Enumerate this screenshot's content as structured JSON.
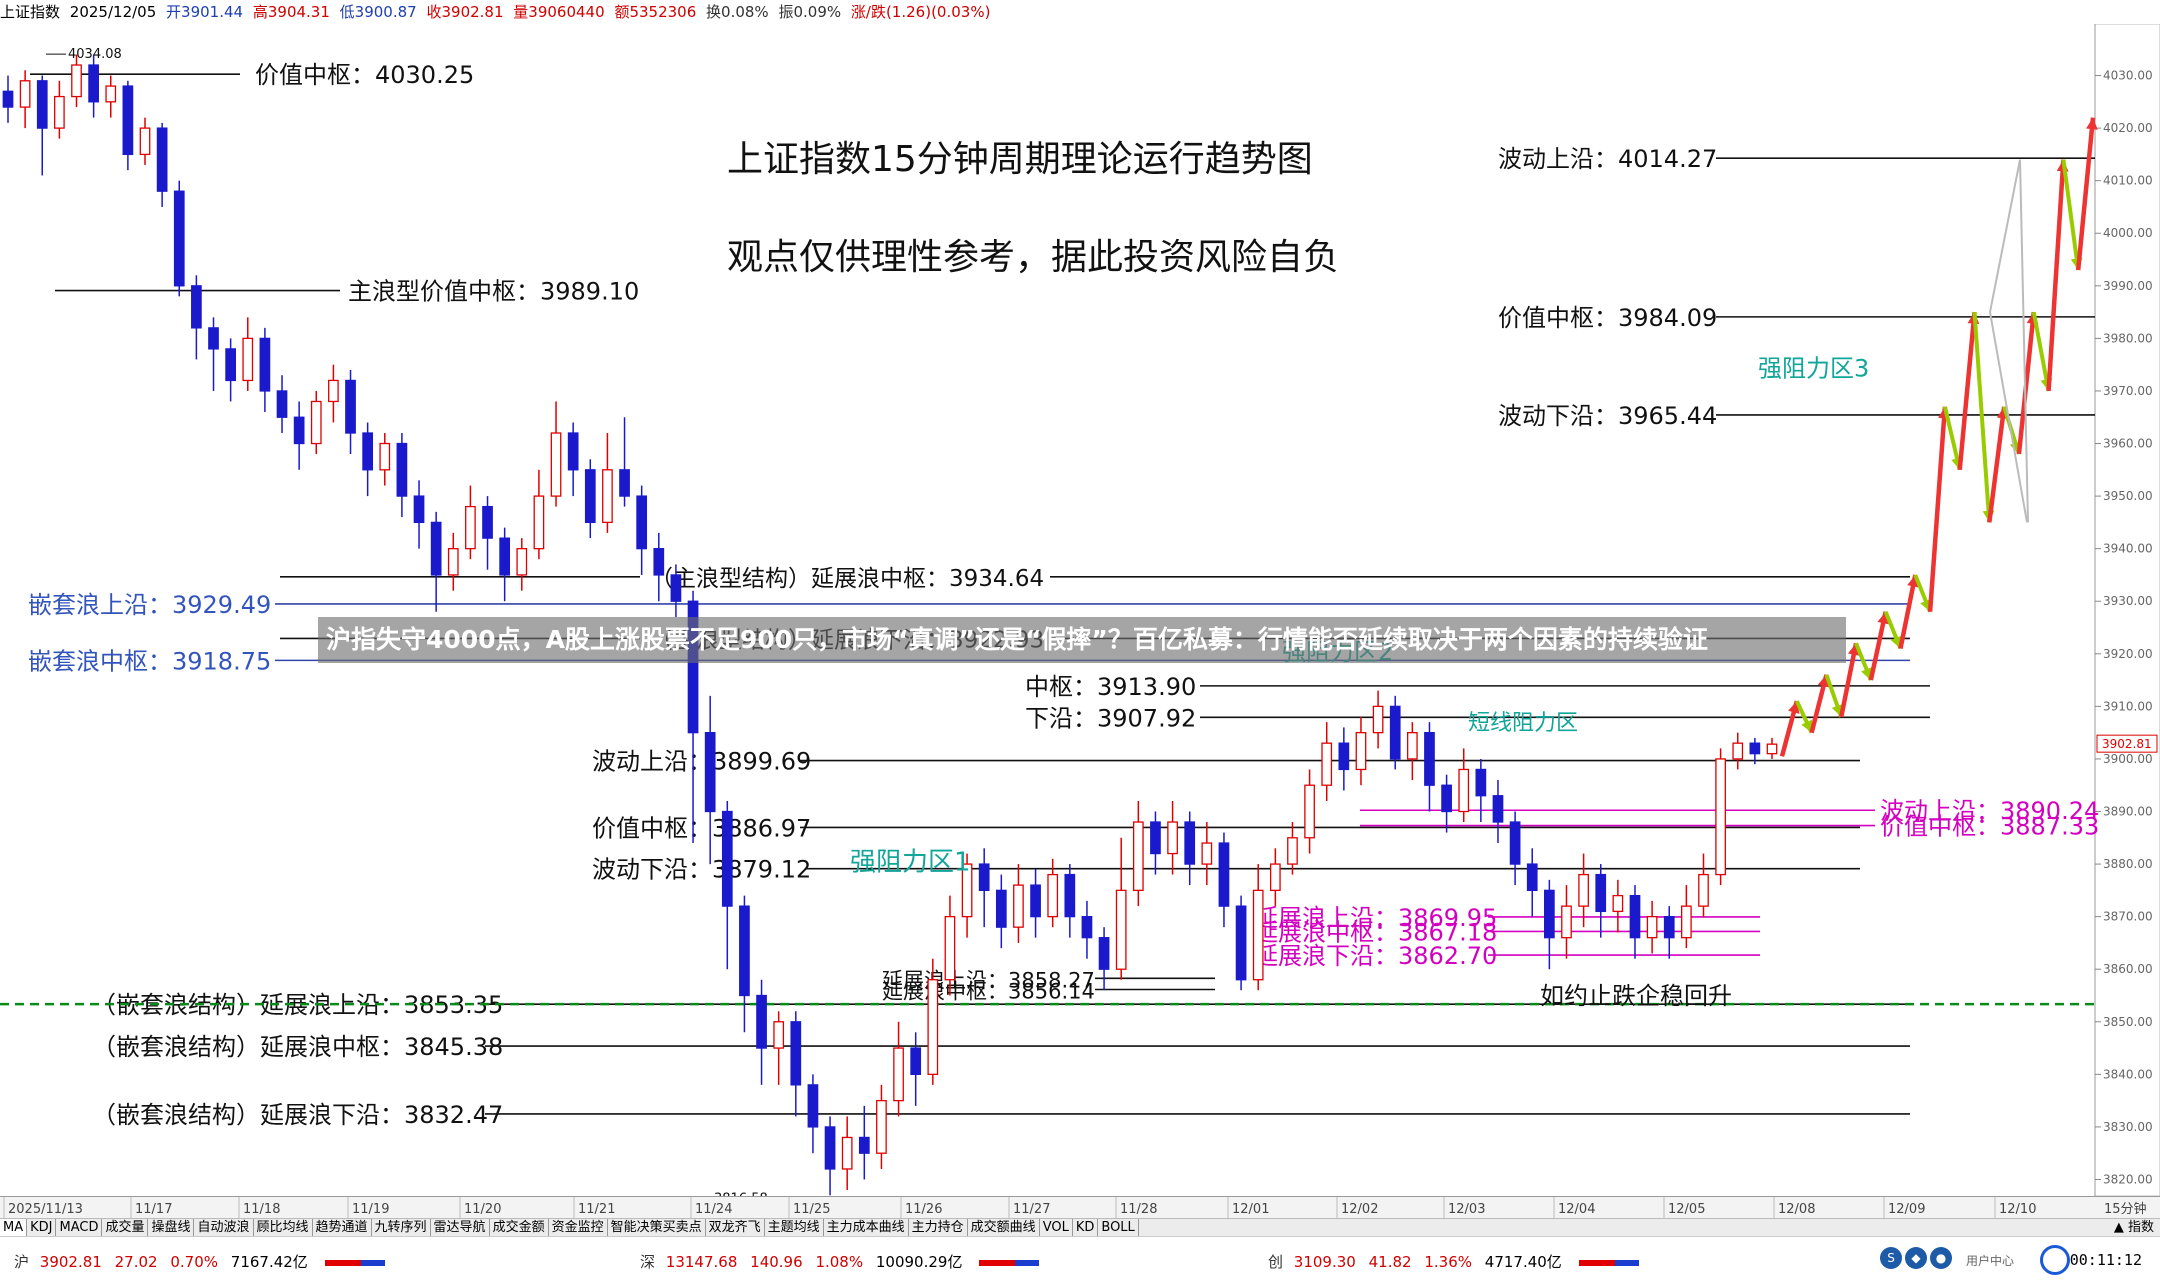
{
  "header": {
    "name": "上证指数",
    "date": "2025/12/05",
    "open": "开3901.44",
    "high": "高3904.31",
    "low": "低3900.87",
    "close": "收3902.81",
    "volume": "量39060440",
    "amount": "额5352306",
    "turnover": "换0.08%",
    "amplitude": "振0.09%",
    "change": "涨/跌(1.26)(0.03%)"
  },
  "chart_data": {
    "type": "candlestick",
    "title": "上证指数15分钟周期理论运行趋势图",
    "subtitle": "观点仅供理性参考，据此投资风险自负",
    "banner": "沪指失守4000点，A股上涨股票不足900只，市场“真调”还是“假摔”？百亿私募：行情能否延续取决于两个因素的持续验证",
    "ylim": [
      3818,
      4036
    ],
    "y_ticks": [
      4030,
      4020,
      4010,
      4000,
      3990,
      3980,
      3970,
      3960,
      3950,
      3940,
      3930,
      3920,
      3910,
      3900,
      3890,
      3880,
      3870,
      3860,
      3850,
      3840,
      3830,
      3820
    ],
    "y_tick_labels": [
      "4030.00",
      "4020.00",
      "4010.00",
      "4000.00",
      "3990.00",
      "3980.00",
      "3970.00",
      "3960.00",
      "3950.00",
      "3940.00",
      "3930.00",
      "3920.00",
      "3910.00",
      "3900.00",
      "3890.00",
      "3880.00",
      "3870.00",
      "3860.00",
      "3850.00",
      "3840.00",
      "3830.00",
      "3820.00"
    ],
    "last_price_label": "3902.81",
    "x_ticks": [
      "2025/11/13",
      "11/17",
      "11/18",
      "11/19",
      "11/20",
      "11/21",
      "11/24",
      "11/25",
      "11/26",
      "11/27",
      "11/28",
      "12/01",
      "12/02",
      "12/03",
      "12/04",
      "12/05",
      "12/08",
      "12/09",
      "12/10"
    ],
    "x_label": "15分钟",
    "peak_label": "4034.08",
    "trough_label": "3816.58",
    "candles": [
      [
        4027,
        4024,
        4030,
        4021
      ],
      [
        4024,
        4029,
        4031,
        4020
      ],
      [
        4029,
        4020,
        4030,
        4011
      ],
      [
        4020,
        4026,
        4029,
        4018
      ],
      [
        4026,
        4032,
        4034,
        4024
      ],
      [
        4032,
        4025,
        4034,
        4022
      ],
      [
        4025,
        4028,
        4030,
        4022
      ],
      [
        4028,
        4015,
        4029,
        4012
      ],
      [
        4015,
        4020,
        4022,
        4013
      ],
      [
        4020,
        4008,
        4021,
        4005
      ],
      [
        4008,
        3990,
        4010,
        3988
      ],
      [
        3990,
        3982,
        3992,
        3976
      ],
      [
        3982,
        3978,
        3984,
        3970
      ],
      [
        3978,
        3972,
        3980,
        3968
      ],
      [
        3972,
        3980,
        3984,
        3970
      ],
      [
        3980,
        3970,
        3982,
        3966
      ],
      [
        3970,
        3965,
        3973,
        3962
      ],
      [
        3965,
        3960,
        3968,
        3955
      ],
      [
        3960,
        3968,
        3970,
        3958
      ],
      [
        3968,
        3972,
        3975,
        3964
      ],
      [
        3972,
        3962,
        3974,
        3958
      ],
      [
        3962,
        3955,
        3964,
        3950
      ],
      [
        3955,
        3960,
        3962,
        3952
      ],
      [
        3960,
        3950,
        3962,
        3946
      ],
      [
        3950,
        3945,
        3953,
        3940
      ],
      [
        3945,
        3935,
        3947,
        3928
      ],
      [
        3935,
        3940,
        3943,
        3932
      ],
      [
        3940,
        3948,
        3952,
        3938
      ],
      [
        3948,
        3942,
        3950,
        3936
      ],
      [
        3942,
        3935,
        3944,
        3930
      ],
      [
        3935,
        3940,
        3942,
        3932
      ],
      [
        3940,
        3950,
        3955,
        3938
      ],
      [
        3950,
        3962,
        3968,
        3948
      ],
      [
        3962,
        3955,
        3964,
        3950
      ],
      [
        3955,
        3945,
        3957,
        3942
      ],
      [
        3945,
        3955,
        3962,
        3943
      ],
      [
        3955,
        3950,
        3965,
        3948
      ],
      [
        3950,
        3940,
        3952,
        3935
      ],
      [
        3940,
        3935,
        3943,
        3930
      ],
      [
        3935,
        3930,
        3937,
        3927
      ],
      [
        3930,
        3905,
        3932,
        3884
      ],
      [
        3905,
        3890,
        3912,
        3880
      ],
      [
        3890,
        3872,
        3892,
        3860
      ],
      [
        3872,
        3855,
        3874,
        3848
      ],
      [
        3855,
        3845,
        3858,
        3838
      ],
      [
        3845,
        3850,
        3852,
        3838
      ],
      [
        3850,
        3838,
        3852,
        3832
      ],
      [
        3838,
        3830,
        3840,
        3825
      ],
      [
        3830,
        3822,
        3832,
        3817
      ],
      [
        3822,
        3828,
        3832,
        3818
      ],
      [
        3828,
        3825,
        3834,
        3820
      ],
      [
        3825,
        3835,
        3838,
        3822
      ],
      [
        3835,
        3845,
        3850,
        3832
      ],
      [
        3845,
        3840,
        3848,
        3834
      ],
      [
        3840,
        3858,
        3862,
        3838
      ],
      [
        3858,
        3870,
        3874,
        3855
      ],
      [
        3870,
        3880,
        3882,
        3866
      ],
      [
        3880,
        3875,
        3883,
        3868
      ],
      [
        3875,
        3868,
        3878,
        3864
      ],
      [
        3868,
        3876,
        3880,
        3865
      ],
      [
        3876,
        3870,
        3879,
        3866
      ],
      [
        3870,
        3878,
        3881,
        3868
      ],
      [
        3878,
        3870,
        3880,
        3866
      ],
      [
        3870,
        3866,
        3873,
        3862
      ],
      [
        3866,
        3860,
        3868,
        3856
      ],
      [
        3860,
        3875,
        3885,
        3858
      ],
      [
        3875,
        3888,
        3892,
        3872
      ],
      [
        3888,
        3882,
        3890,
        3878
      ],
      [
        3882,
        3888,
        3892,
        3878
      ],
      [
        3888,
        3880,
        3890,
        3876
      ],
      [
        3880,
        3884,
        3888,
        3876
      ],
      [
        3884,
        3872,
        3886,
        3868
      ],
      [
        3872,
        3858,
        3874,
        3856
      ],
      [
        3858,
        3875,
        3880,
        3856
      ],
      [
        3875,
        3880,
        3883,
        3872
      ],
      [
        3880,
        3885,
        3888,
        3878
      ],
      [
        3885,
        3895,
        3898,
        3882
      ],
      [
        3895,
        3903,
        3907,
        3892
      ],
      [
        3903,
        3898,
        3906,
        3894
      ],
      [
        3898,
        3905,
        3908,
        3895
      ],
      [
        3905,
        3910,
        3913,
        3902
      ],
      [
        3910,
        3900,
        3912,
        3898
      ],
      [
        3900,
        3905,
        3907,
        3896
      ],
      [
        3905,
        3895,
        3907,
        3890
      ],
      [
        3895,
        3890,
        3897,
        3886
      ],
      [
        3890,
        3898,
        3902,
        3888
      ],
      [
        3898,
        3893,
        3900,
        3888
      ],
      [
        3893,
        3888,
        3896,
        3884
      ],
      [
        3888,
        3880,
        3890,
        3876
      ],
      [
        3880,
        3875,
        3883,
        3870
      ],
      [
        3875,
        3866,
        3877,
        3860
      ],
      [
        3866,
        3872,
        3876,
        3862
      ],
      [
        3872,
        3878,
        3882,
        3868
      ],
      [
        3878,
        3871,
        3880,
        3866
      ],
      [
        3871,
        3874,
        3877,
        3867
      ],
      [
        3874,
        3866,
        3876,
        3862
      ],
      [
        3866,
        3870,
        3873,
        3863
      ],
      [
        3870,
        3866,
        3872,
        3862
      ],
      [
        3866,
        3872,
        3876,
        3864
      ],
      [
        3872,
        3878,
        3882,
        3870
      ],
      [
        3878,
        3900,
        3902,
        3876
      ],
      [
        3900,
        3903,
        3905,
        3898
      ],
      [
        3903,
        3901,
        3904,
        3899
      ],
      [
        3901,
        3902.81,
        3904,
        3900
      ]
    ],
    "levels_left": [
      {
        "label": "价值中枢：4030.25",
        "value": 4030.25
      },
      {
        "label": "主浪型价值中枢：3989.10",
        "value": 3989.1
      },
      {
        "label": "（主浪型结构）延展浪中枢：3934.64",
        "value": 3934.64
      },
      {
        "label": "（主浪型结构）延展浪下沿：3922.93",
        "value": 3922.93
      },
      {
        "label": "嵌套浪上沿：3929.49",
        "value": 3929.49
      },
      {
        "label": "嵌套浪中枢：3918.75",
        "value": 3918.75
      },
      {
        "label": "中枢：3913.90",
        "value": 3913.9
      },
      {
        "label": "下沿：3907.92",
        "value": 3907.92
      },
      {
        "label": "波动上沿：3899.69",
        "value": 3899.69
      },
      {
        "label": "价值中枢：3886.97",
        "value": 3886.97
      },
      {
        "label": "波动下沿：3879.12",
        "value": 3879.12
      },
      {
        "label": "延展浪上沿：3858.27",
        "value": 3858.27
      },
      {
        "label": "延展浪中枢：3856.14",
        "value": 3856.14
      },
      {
        "label": "（嵌套浪结构）延展浪上沿：3853.35",
        "value": 3853.35
      },
      {
        "label": "（嵌套浪结构）延展浪中枢：3845.38",
        "value": 3845.38
      },
      {
        "label": "（嵌套浪结构）延展浪下沿：3832.47",
        "value": 3832.47
      }
    ],
    "levels_right": [
      {
        "label": "波动上沿：4014.27",
        "value": 4014.27
      },
      {
        "label": "价值中枢：3984.09",
        "value": 3984.09
      },
      {
        "label": "波动下沿：3965.44",
        "value": 3965.44
      }
    ],
    "levels_magenta": [
      {
        "label": "波动上沿：3890.24",
        "value": 3890.24
      },
      {
        "label": "价值中枢：3887.33",
        "value": 3887.33
      },
      {
        "label": "延展浪上沿：3869.95",
        "value": 3869.95
      },
      {
        "label": "延展浪中枢：3867.18",
        "value": 3867.18
      },
      {
        "label": "延展浪下沿：3862.70",
        "value": 3862.7
      }
    ],
    "zones": [
      {
        "label": "强阻力区1"
      },
      {
        "label": "强阻力区2"
      },
      {
        "label": "强阻力区3"
      },
      {
        "label": "短线阻力区"
      }
    ],
    "note": "如约止跌企稳回升",
    "projection_path": [
      3900.5,
      3911,
      3905,
      3916,
      3908,
      3922,
      3915,
      3928,
      3921,
      3935,
      3928,
      3967,
      3955,
      3985,
      3945,
      3967,
      3958,
      3985,
      3970,
      4014,
      3993,
      4022
    ]
  },
  "tabs": [
    "MA",
    "KDJ",
    "MACD",
    "成交量",
    "操盘线",
    "自动波浪",
    "顾比均线",
    "趋势通道",
    "九转序列",
    "雷达导航",
    "成交金额",
    "资金监控",
    "智能决策买卖点",
    "双龙齐飞",
    "主题均线",
    "主力成本曲线",
    "主力持仓",
    "成交额曲线",
    "VOL",
    "KD",
    "BOLL"
  ],
  "tabs_right": "指数",
  "status": {
    "sh": {
      "name": "沪",
      "price": "3902.81",
      "chg": "27.02",
      "pct": "0.70%",
      "amt": "7167.42亿"
    },
    "sz": {
      "name": "深",
      "price": "13147.68",
      "chg": "140.96",
      "pct": "1.08%",
      "amt": "10090.29亿"
    },
    "cy": {
      "name": "创",
      "price": "3109.30",
      "chg": "41.82",
      "pct": "1.36%",
      "amt": "4717.40亿"
    },
    "user": "用户中心",
    "time": "00:11:12"
  },
  "colors": {
    "up": "#e00000",
    "down": "#1a1acc",
    "dashed": "#0a8a1a",
    "magenta": "#d400c0",
    "teal": "#12a59a",
    "blue_label": "#3355bb",
    "projection_up": "#ee3333",
    "projection_down": "#99cc00"
  }
}
